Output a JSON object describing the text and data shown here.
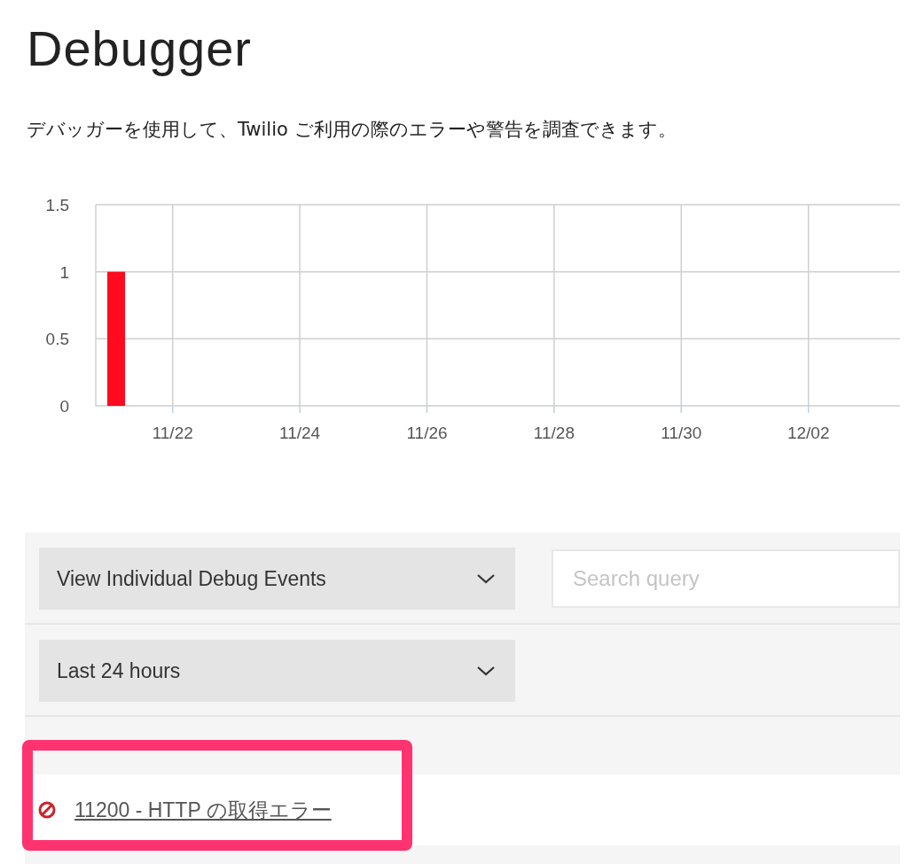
{
  "title": "Debugger",
  "description": "デバッガーを使用して、Twilio ご利用の際のエラーや警告を調査できます。",
  "chart_data": {
    "type": "bar",
    "categories": [
      null,
      "11/22",
      null,
      "11/24",
      null,
      "11/26",
      null,
      "11/28",
      null,
      "11/30",
      null,
      "12/02",
      null
    ],
    "series": [
      {
        "color": "#ff0a1e",
        "values": [
          1,
          0,
          0,
          0,
          0,
          0,
          0,
          0,
          0,
          0,
          0,
          0,
          0
        ]
      }
    ],
    "ylim": [
      0,
      1.5
    ],
    "yticks": [
      0,
      0.5,
      1,
      1.5
    ],
    "grid": true
  },
  "filters": {
    "view": "View Individual Debug Events",
    "search": {
      "placeholder": "Search query"
    },
    "range": "Last 24 hours"
  },
  "events": [
    {
      "kind": "error",
      "label": "11200 - HTTP の取得エラー"
    }
  ]
}
